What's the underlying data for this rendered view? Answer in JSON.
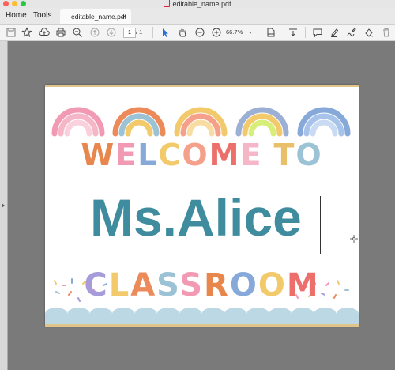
{
  "window": {
    "title": "editable_name.pdf",
    "traffic_lights": [
      "#fe5f57",
      "#febc2e",
      "#28c840"
    ]
  },
  "nav": {
    "home": "Home",
    "tools": "Tools"
  },
  "tab": {
    "filename": "editable_name.pdf",
    "close": "×"
  },
  "toolbar": {
    "page_current": "1",
    "page_total": "/ 1",
    "zoom": "66.7%",
    "icons": [
      "save-icon",
      "star-icon",
      "cloud-upload-icon",
      "print-icon",
      "zoom-out-search-icon",
      "page-up-icon",
      "page-down-icon",
      "select-cursor-icon",
      "hand-icon",
      "zoom-out-icon",
      "zoom-in-icon",
      "fit-page-icon",
      "scroll-mode-icon",
      "comment-icon",
      "highlight-icon",
      "sign-icon",
      "stamp-icon",
      "trash-icon"
    ]
  },
  "document": {
    "welcome_letters": [
      "W",
      "E",
      "L",
      "C",
      "O",
      "M",
      "E",
      " ",
      "T",
      "O"
    ],
    "welcome_colors": [
      "#e8874d",
      "#f29ab3",
      "#86a9d9",
      "#f2c96b",
      "#f4a08a",
      "#ec6f6c",
      "#f5b6c8",
      "#ffffff",
      "#e8c06a",
      "#9cc3d5"
    ],
    "name": "Ms.Alice",
    "name_color": "#3e8c9e",
    "classroom_letters": [
      "C",
      "L",
      "A",
      "S",
      "S",
      "R",
      "O",
      "O",
      "M"
    ],
    "classroom_colors": [
      "#a79bd9",
      "#f2c96b",
      "#ec8a5a",
      "#9cc3d5",
      "#f29ab3",
      "#e8874d",
      "#86a9d9",
      "#f2c96b",
      "#ec6f6c"
    ],
    "scallop_color": "#bcd8e4",
    "rainbow_colors": [
      [
        "#f29ab3",
        "#f5b6c8",
        "#f9d0dc"
      ],
      [
        "#ec8a5a",
        "#9cc3d5",
        "#f2c96b"
      ],
      [
        "#f2c96b",
        "#f4a08a",
        "#f9dca2"
      ],
      [
        "#9cb0d6",
        "#f2c96b",
        "#d7ee7a"
      ],
      [
        "#86a9d9",
        "#a8c3ea",
        "#c9dbf3"
      ]
    ]
  }
}
